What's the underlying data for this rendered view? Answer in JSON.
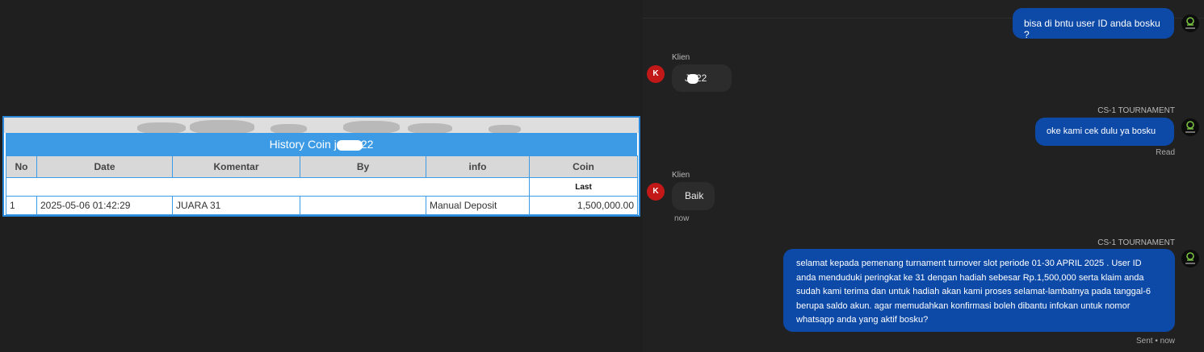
{
  "history": {
    "title": "History Coin j",
    "title_suffix": "22",
    "columns": [
      "No",
      "Date",
      "Komentar",
      "By",
      "info",
      "Coin"
    ],
    "sub_header": "Last",
    "rows": [
      {
        "no": "1",
        "date": "2025-05-06 01:42:29",
        "komentar": "JUARA 31",
        "by": "",
        "info": "Manual Deposit",
        "coin": "1,500,000.00"
      }
    ]
  },
  "chat": {
    "messages": [
      {
        "text": "bisa di bntu user ID anda bosku ?"
      },
      {
        "sender": "Klien",
        "avatar": "K",
        "text_prefix": "J",
        "text_suffix": "22"
      },
      {
        "sender": "CS-1 TOURNAMENT",
        "text": "oke kami cek dulu ya bosku",
        "status": "Read"
      },
      {
        "sender": "Klien",
        "avatar": "K",
        "text": "Baik",
        "time": "now"
      },
      {
        "sender": "CS-1 TOURNAMENT",
        "text": "selamat kepada pemenang turnament turnover slot periode 01-30 APRIL 2025 . User ID anda menduduki peringkat ke 31 dengan hadiah sebesar Rp.1,500,000 serta klaim anda sudah kami terima dan untuk hadiah akan kami proses selamat-lambatnya pada tanggal-6 berupa saldo akun. agar memudahkan konfirmasi boleh dibantu infokan untuk nomor whatsapp anda yang aktif bosku?",
        "status": "Sent • now"
      }
    ]
  },
  "colors": {
    "table_accent": "#3d9be6",
    "out_bubble": "#0d4aa8",
    "in_bubble": "#2c2c2c",
    "avatar": "#c21818",
    "coin_text": "#2e8b2e"
  }
}
